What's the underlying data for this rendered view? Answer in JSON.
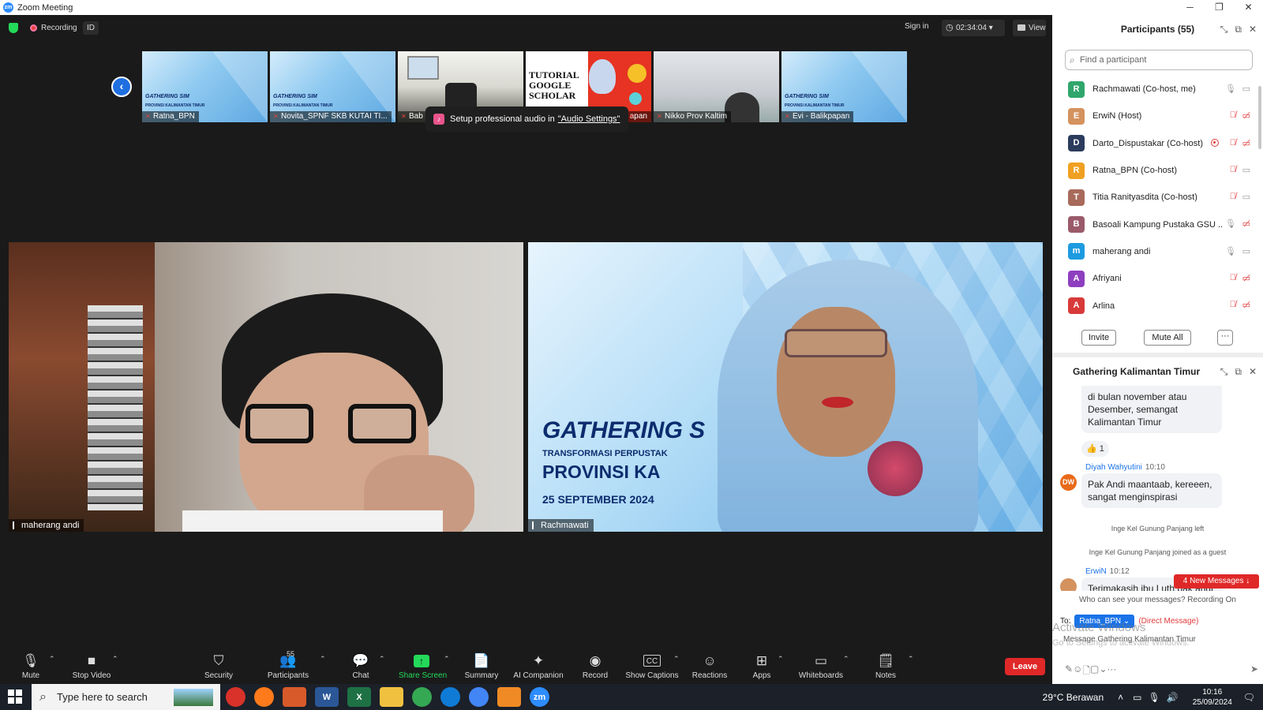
{
  "window": {
    "title": "Zoom Meeting",
    "icon_text": "zm",
    "controls": [
      "─",
      "❐",
      "✕"
    ]
  },
  "topbar": {
    "recording": "Recording",
    "id": "ID",
    "sign_in": "Sign in",
    "timer": "02:34:04",
    "timer_caret": "▾",
    "view": "View",
    "prev_glyph": "‹"
  },
  "thumbnails": [
    {
      "name": "Ratna_BPN",
      "kind": "gathering",
      "line1": "GATHERING SIM",
      "line2": "PROVINSI KALIMANTAN TIMUR"
    },
    {
      "name": "Novita_SPNF SKB KUTAI TI...",
      "kind": "gathering",
      "line1": "GATHERING SIM",
      "line2": "PROVINSI KALIMANTAN TIMUR"
    },
    {
      "name": "Bab",
      "kind": "room"
    },
    {
      "name": "apan",
      "kind": "tutorial",
      "title": "TUTORIAL GOOGLE SCHOLAR"
    },
    {
      "name": "Nikko Prov Kaltim",
      "kind": "blur"
    },
    {
      "name": "Evi - Balikpapan",
      "kind": "gathering",
      "line1": "GATHERING SIM",
      "line2": "PROVINSI KALIMANTAN TIMUR"
    }
  ],
  "toast": {
    "icon": "♪",
    "text": "Setup professional audio in",
    "link": "\"Audio Settings\""
  },
  "videos": {
    "left_name": "maherang andi",
    "right_name": "Rachmawati",
    "slide": {
      "title": "GATHERING S",
      "subtitle": "TRANSFORMASI PERPUSTAK",
      "province": "PROVINSI KA",
      "date": "25 SEPTEMBER 2024"
    }
  },
  "toolbar": {
    "mute": "Mute",
    "stop_video": "Stop Video",
    "security": "Security",
    "participants": "Participants",
    "participants_count": "55",
    "chat": "Chat",
    "share_screen": "Share Screen",
    "summary": "Summary",
    "ai_companion": "AI Companion",
    "record": "Record",
    "show_captions": "Show Captions",
    "captions_icon": "CC",
    "reactions": "Reactions",
    "apps": "Apps",
    "whiteboards": "Whiteboards",
    "notes": "Notes",
    "leave": "Leave",
    "caret": "⌃"
  },
  "participants_panel": {
    "title": "Participants (55)",
    "search_placeholder": "Find a participant",
    "people": [
      {
        "name": "Rachmawati (Co-host, me)",
        "initial": "R",
        "color": "#2ea66c",
        "mic": "on",
        "cam": "on"
      },
      {
        "name": "ErwiN (Host)",
        "initial": "E",
        "color": "#d4925f",
        "mic": "muted",
        "cam": "off"
      },
      {
        "name": "Darto_Dispustakar (Co-host)",
        "initial": "D",
        "color": "#2b3b5c",
        "mic": "muted",
        "cam": "off",
        "rec": true
      },
      {
        "name": "Ratna_BPN (Co-host)",
        "initial": "R",
        "color": "#f0a020",
        "mic": "muted",
        "cam": "on"
      },
      {
        "name": "Titia Ranityasdita (Co-host)",
        "initial": "T",
        "color": "#a86a5a",
        "mic": "muted",
        "cam": "on"
      },
      {
        "name": "Basoali Kampung Pustaka GSU ...",
        "initial": "B",
        "color": "#9a5a6a",
        "mic": "on",
        "cam": "off"
      },
      {
        "name": "maherang andi",
        "initial": "m",
        "color": "#1e9be0",
        "mic": "on",
        "cam": "on"
      },
      {
        "name": "Afriyani",
        "initial": "A",
        "color": "#8e3fc0",
        "mic": "muted",
        "cam": "off"
      },
      {
        "name": "Arlina",
        "initial": "A",
        "color": "#d83a3a",
        "mic": "muted",
        "cam": "off"
      }
    ],
    "invite": "Invite",
    "mute_all": "Mute All",
    "more": "···"
  },
  "chat_panel": {
    "title": "Gathering Kalimantan Timur",
    "msg1": "di bulan november atau Desember, semangat Kalimantan Timur",
    "reaction": "👍 1",
    "sender2": "Diyah Wahyutini",
    "time2": "10:10",
    "initials2": "DW",
    "msg2": "Pak Andi maantaab, kereeen, sangat menginspirasi",
    "sys1": "Inge Kel Gunung Panjang left",
    "sys2": "Inge Kel Gunung Panjang joined as a guest",
    "sender3": "ErwiN",
    "time3": "10:12",
    "msg3": "Terimakasih ibu Luth pak andi atas sharing",
    "new_messages": "4 New Messages ↓",
    "who_can_see": "Who can see your messages? Recording On",
    "to_label": "To:",
    "to_recipient": "Ratna_BPN ⌄",
    "direct": "(Direct Message)",
    "input_placeholder": "Message Gathering Kalimantan Timur",
    "watermark1": "Activate Windows",
    "watermark2": "Go to Settings to activate Windows."
  },
  "taskbar": {
    "search_placeholder": "Type here to search",
    "weather": "29°C  Berawan",
    "time": "10:16",
    "date": "25/09/2024",
    "apps": [
      {
        "label": "",
        "color": "#d8322a"
      },
      {
        "label": "",
        "color": "#ff7a1a"
      },
      {
        "label": "",
        "color": "#d85a2a"
      },
      {
        "label": "W",
        "color": "#2b5797"
      },
      {
        "label": "X",
        "color": "#1e7145"
      },
      {
        "label": "",
        "color": "#f0c040"
      },
      {
        "label": "",
        "color": "#34a853"
      },
      {
        "label": "",
        "color": "#0f7bd6"
      },
      {
        "label": "",
        "color": "#4285f4"
      },
      {
        "label": "",
        "color": "#f08a24"
      },
      {
        "label": "zm",
        "color": "#2d8cff"
      }
    ]
  }
}
